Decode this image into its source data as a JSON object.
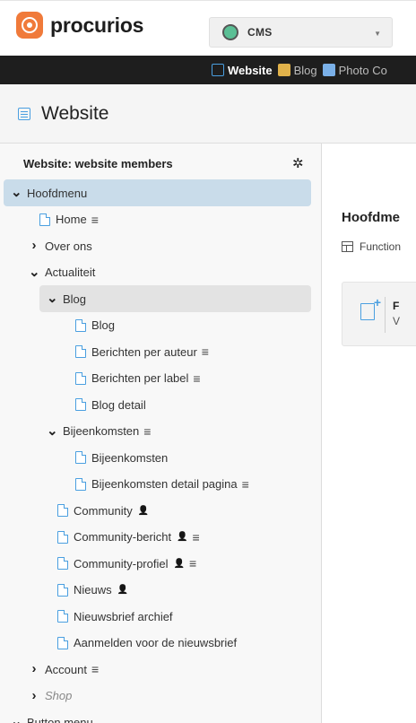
{
  "header": {
    "logo_text": "procurios",
    "cms_select": "CMS"
  },
  "nav": {
    "items": [
      {
        "label": "Website",
        "icon": "website-icon",
        "active": true
      },
      {
        "label": "Blog",
        "icon": "blog-icon",
        "active": false
      },
      {
        "label": "Photo Co",
        "icon": "photo-icon",
        "active": false
      }
    ]
  },
  "page": {
    "title": "Website"
  },
  "sidebar": {
    "title": "Website: website members",
    "tree": [
      {
        "label": "Hoofdmenu",
        "chev": "down",
        "level": 0,
        "type": "menu",
        "selected": true
      },
      {
        "label": "Home",
        "level": 1,
        "type": "page",
        "menu": true
      },
      {
        "label": "Over ons",
        "chev": "right",
        "level": 1,
        "type": "menu"
      },
      {
        "label": "Actualiteit",
        "chev": "down",
        "level": 1,
        "type": "menu"
      },
      {
        "label": "Blog",
        "chev": "down",
        "level": 2,
        "type": "menu",
        "highlight": true
      },
      {
        "label": "Blog",
        "level": 3,
        "type": "page"
      },
      {
        "label": "Berichten per auteur",
        "level": 3,
        "type": "page",
        "menu": true
      },
      {
        "label": "Berichten per label",
        "level": 3,
        "type": "page",
        "menu": true
      },
      {
        "label": "Blog detail",
        "level": 3,
        "type": "page"
      },
      {
        "label": "Bijeenkomsten",
        "chev": "down",
        "level": 2,
        "type": "menu",
        "menu": true
      },
      {
        "label": "Bijeenkomsten",
        "level": 3,
        "type": "page"
      },
      {
        "label": "Bijeenkomsten detail pagina",
        "level": 3,
        "type": "page",
        "menu": true
      },
      {
        "label": "Community",
        "level": 2,
        "type": "page",
        "user": true
      },
      {
        "label": "Community-bericht",
        "level": 2,
        "type": "page",
        "user": true,
        "menu": true
      },
      {
        "label": "Community-profiel",
        "level": 2,
        "type": "page",
        "user": true,
        "menu": true
      },
      {
        "label": "Nieuws",
        "level": 2,
        "type": "page",
        "user": true
      },
      {
        "label": "Nieuwsbrief archief",
        "level": 2,
        "type": "page"
      },
      {
        "label": "Aanmelden voor de nieuwsbrief",
        "level": 2,
        "type": "page"
      },
      {
        "label": "Account",
        "chev": "right",
        "level": 1,
        "type": "menu",
        "menu": true
      },
      {
        "label": "Shop",
        "chev": "right",
        "level": 1,
        "type": "menu",
        "italic": true
      },
      {
        "label": "Button menu",
        "chev": "down",
        "level": 0,
        "type": "menu"
      }
    ]
  },
  "main": {
    "heading": "Hoofdme",
    "func_label": "Function",
    "card_title": "F",
    "card_sub": "V"
  }
}
